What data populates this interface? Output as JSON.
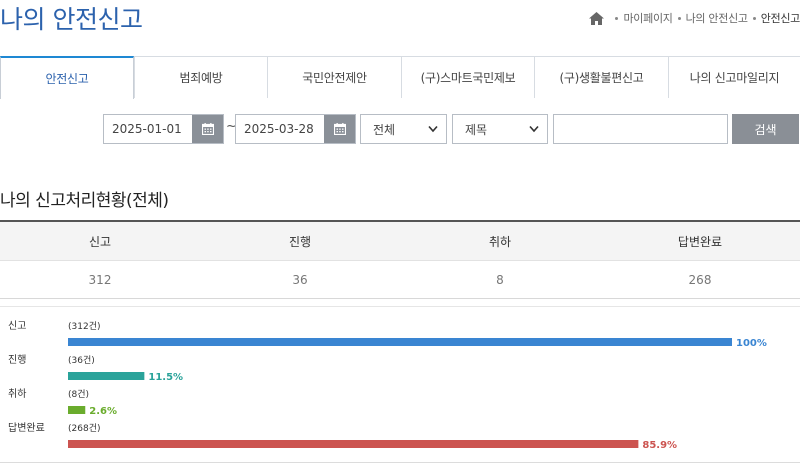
{
  "page": {
    "title": "나의 안전신고"
  },
  "breadcrumb": {
    "items": [
      "마이페이지",
      "나의 안전신고",
      "안전신고"
    ]
  },
  "tabs": [
    {
      "label": "안전신고",
      "active": true
    },
    {
      "label": "범죄예방",
      "active": false
    },
    {
      "label": "국민안전제안",
      "active": false
    },
    {
      "label": "(구)스마트국민제보",
      "active": false
    },
    {
      "label": "(구)생활불편신고",
      "active": false
    },
    {
      "label": "나의 신고마일리지",
      "active": false
    }
  ],
  "search": {
    "start_date": "2025-01-01",
    "tilde": "~",
    "end_date": "2025-03-28",
    "category_select": "전체",
    "field_select": "제목",
    "keyword": "",
    "button_label": "검색"
  },
  "status": {
    "title": "나의 신고처리현황(전체)",
    "headers": [
      "신고",
      "진행",
      "취하",
      "답변완료"
    ],
    "values": [
      "312",
      "36",
      "8",
      "268"
    ]
  },
  "colors": {
    "brand": "#2c62ad",
    "tab_active_border": "#1e88d3",
    "bar_report": "#3a85d2",
    "bar_progress": "#2aa39a",
    "bar_withdraw": "#6aac2d",
    "bar_done": "#cc5450"
  },
  "chart_data": {
    "type": "bar",
    "orientation": "horizontal",
    "categories": [
      "신고",
      "진행",
      "취하",
      "답변완료"
    ],
    "counts": [
      "(312건)",
      "(36건)",
      "(8건)",
      "(268건)"
    ],
    "values": [
      312,
      36,
      8,
      268
    ],
    "percent_labels": [
      "100%",
      "11.5%",
      "2.6%",
      "85.9%"
    ],
    "percent": [
      100,
      11.5,
      2.6,
      85.9
    ],
    "colors": [
      "#3a85d2",
      "#2aa39a",
      "#6aac2d",
      "#cc5450"
    ],
    "xlim": [
      0,
      100
    ],
    "grid": false
  }
}
